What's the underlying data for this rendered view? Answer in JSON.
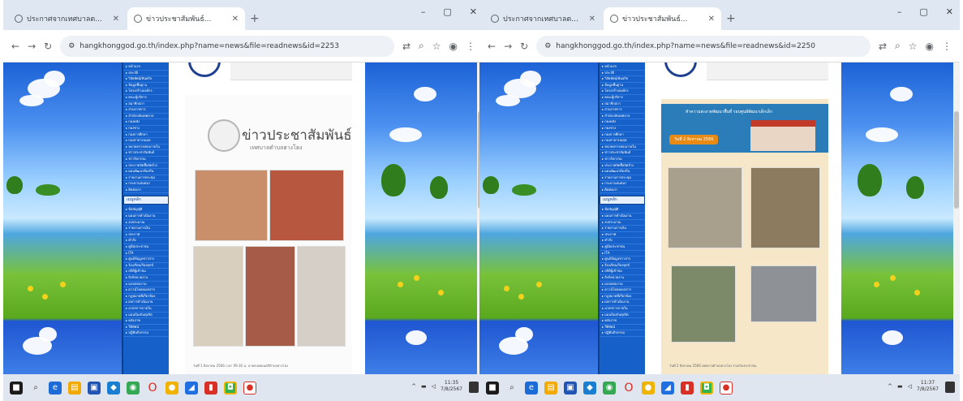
{
  "left": {
    "tabs": [
      {
        "title": "ประกาศจากเทศบาลต..."
      },
      {
        "title": "ข่าวประชาสัมพันธ์..."
      }
    ],
    "url": "hangkhonggod.go.th/index.php?name=news&file=readnews&id=2253",
    "poster_title": "ข่าวประชาสัมพันธ์",
    "poster_subtitle": "เทศบาลตำบลฮางโฮง",
    "poster_footer": "วันที่ 1 สิงหาคม 2566 เวลา 09.30 น. นายกเทศมนตรีตำบลฮางโฮง",
    "clock_time": "11:35",
    "clock_date": "7/8/2567"
  },
  "right": {
    "tabs": [
      {
        "title": "ประกาศจากเทศบาลต..."
      },
      {
        "title": "ข่าวประชาสัมพันธ์..."
      }
    ],
    "url": "hangkhonggod.go.th/index.php?name=news&file=readnews&id=2250",
    "banner_title": "ทำความสะอาดพัฒนาพื้นที่ รอบศูนย์พัฒนาเด็กเล็ก",
    "banner_date": "วันที่ 2 สิงหาคม 2566",
    "poster_footer": "วันที่ 2 สิงหาคม 2566 เทศบาลตำบลฮางโฮง ร่วมกับประชาชน",
    "clock_time": "11:37",
    "clock_date": "7/8/2567"
  },
  "menu_items": [
    "หน้าแรก",
    "ประวัติ",
    "วิสัยทัศน์/พันธกิจ",
    "ข้อมูลพื้นฐาน",
    "โครงสร้างองค์กร",
    "คณะผู้บริหาร",
    "สมาชิกสภา",
    "ส่วนราชการ",
    "สำนักปลัดเทศบาล",
    "กองคลัง",
    "กองช่าง",
    "กองการศึกษา",
    "กองสาธารณสุข",
    "หน่วยตรวจสอบภายใน",
    "ข่าวประชาสัมพันธ์",
    "ข่าวกิจกรรม",
    "ประกาศจัดซื้อจัดจ้าง",
    "แผนพัฒนาท้องถิ่น",
    "รายงานการประชุม",
    "กระดานสนทนา",
    "ติดต่อเรา"
  ],
  "menu_head": "เมนูหลัก",
  "menu_items2": [
    "ข้อบัญญัติ",
    "แผนการดำเนินงาน",
    "งบประมาณ",
    "รายงานการเงิน",
    "ประกาศ",
    "คำสั่ง",
    "คู่มือประชาชน",
    "ITA",
    "ศูนย์ข้อมูลข่าวสาร",
    "ร้องเรียน/ร้องทุกข์",
    "สถิติผู้เข้าชม",
    "ลิงก์หน่วยงาน",
    "แบบสอบถาม",
    "ดาวน์โหลดเอกสาร",
    "กฎหมายที่เกี่ยวข้อง",
    "ผลการดำเนินงาน",
    "มาตรการภายใน",
    "แผนป้องกันทุจริต",
    "คลังภาพ",
    "วีดิทัศน์",
    "ปฏิทินกิจกรรม"
  ]
}
